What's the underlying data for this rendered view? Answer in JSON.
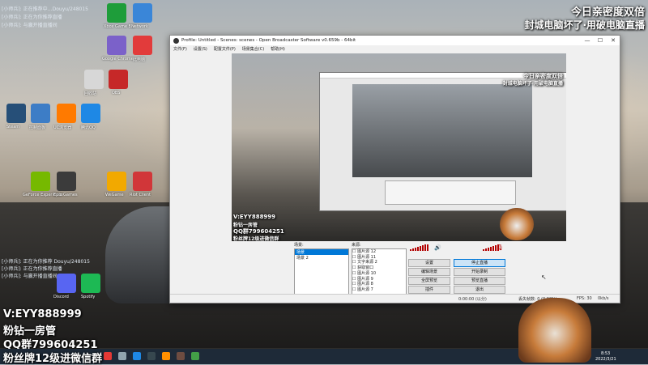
{
  "side_log": [
    "[小师兵]: 正在推荐中…Douyu/248015",
    "[小师兵]: 正在为你推荐直播",
    "[小师兵]: 与赢开播直播间"
  ],
  "side_log_bottom": [
    "[小师兵]: 正在为你推荐 Douyu/248015",
    "[小师兵]: 正在为你推荐直播",
    "[小师兵]: 与赢开播直播间"
  ],
  "desktop_icons": [
    {
      "label": "Xbox Game Bar"
    },
    {
      "label": "Network"
    },
    {
      "label": "Google Chrome"
    },
    {
      "label": "此电脑"
    },
    {
      "label": "回收站"
    },
    {
      "label": "OBS"
    },
    {
      "label": "Steam"
    },
    {
      "label": "控制面板"
    },
    {
      "label": "UC浏览器"
    },
    {
      "label": "腾讯QQ"
    },
    {
      "label": "GeForce Experience"
    },
    {
      "label": "Epic Games"
    },
    {
      "label": "WeGame"
    },
    {
      "label": "Riot Client"
    },
    {
      "label": "Discord"
    },
    {
      "label": "Spotify"
    }
  ],
  "overlay": {
    "line1": "今日亲密度双倍",
    "line2": "封城电脑坏了·用破电脑直播"
  },
  "streamer_info": {
    "vx": "V:EYY888999",
    "fan": "粉钻一房管",
    "qq": "QQ群799604251",
    "badge": "粉丝牌12级进微信群"
  },
  "preview_info": {
    "vx": "V:EYY888999",
    "fan": "粉钻一房管",
    "qq": "QQ群799604251",
    "badge": "粉丝牌12级进微信群"
  },
  "obs": {
    "title": "Profile: Untitled - Scenes: scenes - Open Broadcaster Software v0.659b - 64bit",
    "menu": [
      "文件(F)",
      "设置(S)",
      "配置文件(P)",
      "场景集合(C)",
      "帮助(H)"
    ],
    "scenes_label": "场景:",
    "scenes": [
      "场景",
      "场景 2"
    ],
    "sources_label": "来源:",
    "sources": [
      "图片源 12",
      "图片源 11",
      "文字来源 2",
      "获取窗口",
      "图片源 10",
      "图片源 9",
      "图片源 8",
      "图片源 7"
    ],
    "buttons": {
      "settings": "设置",
      "stop_stream": "停止直播",
      "edit_scene": "编辑场景",
      "start_recording": "开始录制",
      "fullscreen": "全屏预览",
      "preview_stream": "预览直播",
      "plugins": "插件",
      "exit": "退出"
    },
    "status": {
      "time": "0:00:00 (以分)",
      "dropped": "丢失帧数: 0 (0.00%)",
      "fps": "FPS: 30",
      "bitrate": "0kb/s"
    }
  },
  "taskbar": {
    "time": "8:53",
    "date": "2022/3/21"
  },
  "colors": {
    "overlay_text": "#ffffff",
    "meter_red": "#b30000",
    "taskbar": "#1e2a38",
    "obs_bg": "#f0f0f0"
  }
}
